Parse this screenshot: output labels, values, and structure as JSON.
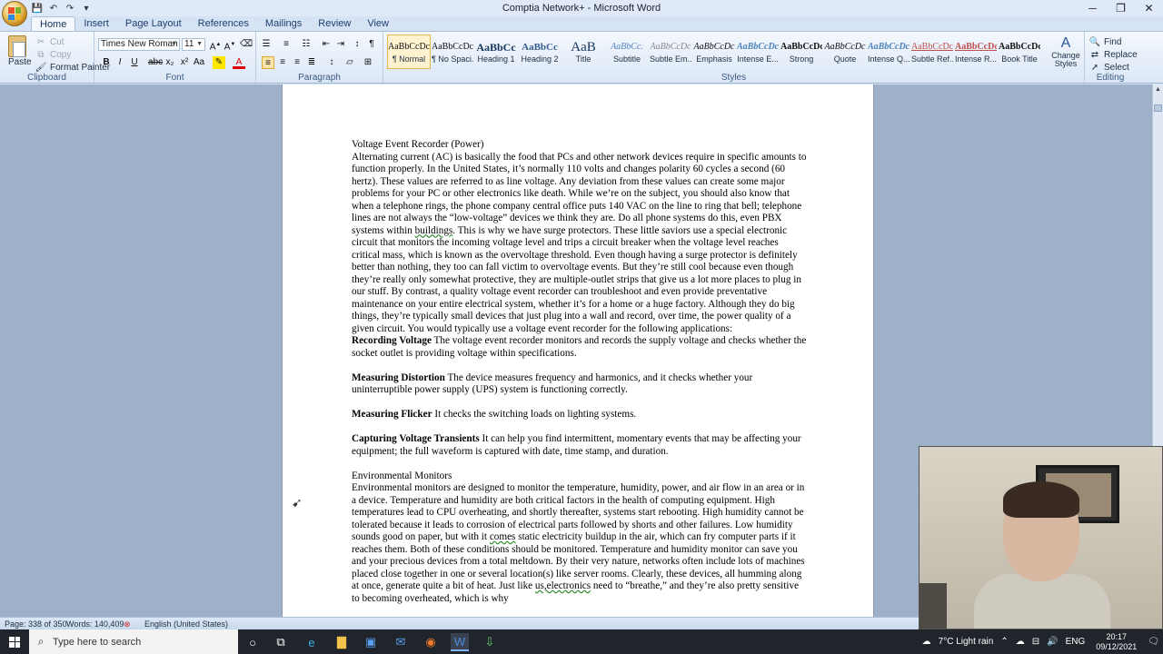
{
  "window": {
    "title": "Comptia Network+ - Microsoft Word",
    "controls": {
      "minimize": "─",
      "restore": "❐",
      "close": "✕"
    }
  },
  "ribbon_tabs": [
    "Home",
    "Insert",
    "Page Layout",
    "References",
    "Mailings",
    "Review",
    "View"
  ],
  "clipboard": {
    "paste": "Paste",
    "cut": "Cut",
    "copy": "Copy",
    "format_painter": "Format Painter",
    "label": "Clipboard"
  },
  "font": {
    "name": "Times New Roman",
    "size": "11",
    "label": "Font"
  },
  "paragraph": {
    "label": "Paragraph"
  },
  "styles": {
    "label": "Styles",
    "items": [
      {
        "sample": "AaBbCcDc",
        "name": "¶ Normal"
      },
      {
        "sample": "AaBbCcDc",
        "name": "¶ No Spaci..."
      },
      {
        "sample": "AaBbCc",
        "name": "Heading 1"
      },
      {
        "sample": "AaBbCc",
        "name": "Heading 2"
      },
      {
        "sample": "AaB",
        "name": "Title"
      },
      {
        "sample": "AaBbCc.",
        "name": "Subtitle"
      },
      {
        "sample": "AaBbCcDc",
        "name": "Subtle Em..."
      },
      {
        "sample": "AaBbCcDc",
        "name": "Emphasis"
      },
      {
        "sample": "AaBbCcDc",
        "name": "Intense E..."
      },
      {
        "sample": "AaBbCcDc",
        "name": "Strong"
      },
      {
        "sample": "AaBbCcDc",
        "name": "Quote"
      },
      {
        "sample": "AaBbCcDc",
        "name": "Intense Q..."
      },
      {
        "sample": "AaBbCcDc",
        "name": "Subtle Ref..."
      },
      {
        "sample": "AaBbCcDc",
        "name": "Intense R..."
      },
      {
        "sample": "AaBbCcDc",
        "name": "Book Title"
      }
    ],
    "change_styles": "Change Styles"
  },
  "editing": {
    "find": "Find",
    "replace": "Replace",
    "select": "Select",
    "label": "Editing"
  },
  "document": {
    "heading1": "Voltage Event Recorder (Power)",
    "para1": "Alternating current (AC) is basically the food that PCs and other network devices require in specific amounts to function properly. In the United States, it’s normally 110 volts and changes polarity 60 cycles a second (60 hertz). These values are referred to as line voltage. Any deviation from these values can create some major problems for your PC or other electronics like death. While we’re on the subject, you should also know that when a telephone rings, the phone company central office puts 140 VAC on the line to ring that bell; telephone lines are not always the “low-voltage” devices we think they are. Do all phone systems do this, even PBX systems within ",
    "para1_underlined": "buildings",
    "para1_rest": ". This is why we have surge protectors. These little saviors use a special electronic circuit that monitors the incoming voltage level and trips a circuit breaker when the voltage level reaches critical mass, which is known as the overvoltage threshold. Even though having a surge protector is definitely better than nothing, they too can fall victim to overvoltage events. But they’re still cool because even though they’re really only somewhat protective, they are multiple-outlet strips that give us a lot more places to plug in our stuff. By contrast, a quality voltage event recorder can troubleshoot and even provide preventative maintenance on your entire electrical system, whether it’s for a home or a huge factory. Although they do big things, they’re typically small devices that just plug into a wall and record, over time, the power quality of a given circuit. You would typically use a voltage event recorder for the following applications:",
    "item1_title": "Recording Voltage",
    "item1_text": " The voltage event recorder monitors and records the supply voltage and checks whether the socket outlet is providing voltage within specifications.",
    "item2_title": "Measuring Distortion",
    "item2_text": " The device measures frequency and harmonics, and it checks whether your uninterruptible power supply (UPS) system is functioning correctly.",
    "item3_title": "Measuring Flicker",
    "item3_text": " It checks the switching loads on lighting systems.",
    "item4_title": "Capturing Voltage Transients",
    "item4_text": " It can help you find intermittent, momentary events that may be affecting your equipment; the full waveform is captured with date, time stamp, and duration.",
    "heading2": "Environmental Monitors",
    "para2": "Environmental monitors are designed to monitor the temperature, humidity, power, and air flow in an area or in a device. Temperature and humidity are both critical factors in the health of computing equipment. High temperatures lead to CPU overheating, and shortly thereafter, systems start rebooting. High humidity cannot be tolerated because it leads to corrosion of electrical parts followed by shorts and other failures. Low humidity sounds good on paper, but with it ",
    "para2_underlined": "comes",
    "para2_rest": " static electricity buildup in the air, which can fry computer parts if it reaches them. Both of these conditions should be monitored. Temperature and humidity monitor can save you and your precious devices from a total meltdown. By their very nature, networks often include lots of machines placed close together in one or several location(s) like server rooms. Clearly, these devices, all humming along at once, generate quite a bit of heat. Just like ",
    "para2_underlined2": "us,electronics",
    "para2_rest2": " need to “breathe,” and they’re also pretty sensitive to becoming overheated, which is why"
  },
  "status": {
    "page": "Page: 338 of 350",
    "words": "Words: 140,409",
    "language": "English (United States)"
  },
  "taskbar": {
    "search_placeholder": "Type here to search",
    "weather": "7°C  Light rain",
    "lang": "ENG",
    "time": "20:17",
    "date": "09/12/2021"
  },
  "colors": {
    "ribbon_bg": "#dbe7f6",
    "taskbar_bg": "#20242b",
    "style_selected": "#fff3cf"
  }
}
